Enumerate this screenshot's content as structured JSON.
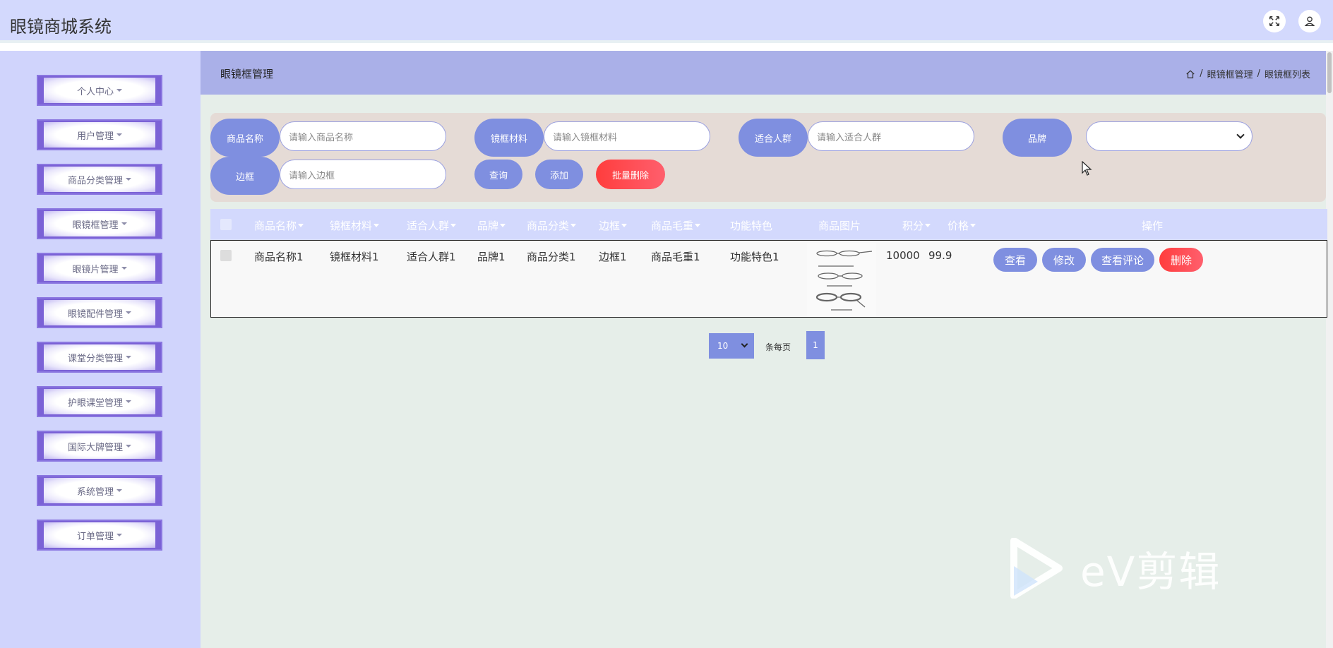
{
  "header": {
    "title": "眼镜商城系统",
    "fullscreen_icon": "fullscreen-icon",
    "user_icon": "user-icon"
  },
  "sidebar": {
    "items": [
      {
        "label": "个人中心"
      },
      {
        "label": "用户管理"
      },
      {
        "label": "商品分类管理"
      },
      {
        "label": "眼镜框管理"
      },
      {
        "label": "眼镜片管理"
      },
      {
        "label": "眼镜配件管理"
      },
      {
        "label": "课堂分类管理"
      },
      {
        "label": "护眼课堂管理"
      },
      {
        "label": "国际大牌管理"
      },
      {
        "label": "系统管理"
      },
      {
        "label": "订单管理"
      }
    ]
  },
  "page": {
    "title": "眼镜框管理",
    "breadcrumb": {
      "home_icon": "home-icon",
      "sep": "/",
      "level1": "眼镜框管理",
      "level2": "眼镜框列表"
    }
  },
  "search": {
    "name_label": "商品名称",
    "name_placeholder": "请输入商品名称",
    "material_label": "镜框材料",
    "material_placeholder": "请输入镜框材料",
    "crowd_label": "适合人群",
    "crowd_placeholder": "请输入适合人群",
    "brand_label": "品牌",
    "brand_value": "",
    "frame_label": "边框",
    "frame_placeholder": "请输入边框",
    "query_btn": "查询",
    "add_btn": "添加",
    "batch_delete_btn": "批量删除"
  },
  "table": {
    "headers": [
      "商品名称",
      "镜框材料",
      "适合人群",
      "品牌",
      "商品分类",
      "边框",
      "商品毛重",
      "功能特色",
      "商品图片",
      "积分",
      "价格",
      "操作"
    ],
    "rows": [
      {
        "name": "商品名称1",
        "material": "镜框材料1",
        "crowd": "适合人群1",
        "brand": "品牌1",
        "category": "商品分类1",
        "frame": "边框1",
        "weight": "商品毛重1",
        "feature": "功能特色1",
        "points": "10000",
        "price": "99.9",
        "actions": {
          "view": "查看",
          "edit": "修改",
          "comments": "查看评论",
          "delete": "删除"
        }
      }
    ]
  },
  "pagination": {
    "page_size": "10",
    "per_page_text": "条每页",
    "current_page": "1"
  },
  "watermark": {
    "text": "eV剪辑"
  },
  "colors": {
    "header_bg": "#d3d9fd",
    "sidebar_bg": "#d0d4fc",
    "accent": "#7f8fe0",
    "danger": "#ff4d4d",
    "menu_border": "#7b62d6",
    "main_bg": "#e6eee9",
    "search_panel_bg": "#e5dbd6"
  }
}
